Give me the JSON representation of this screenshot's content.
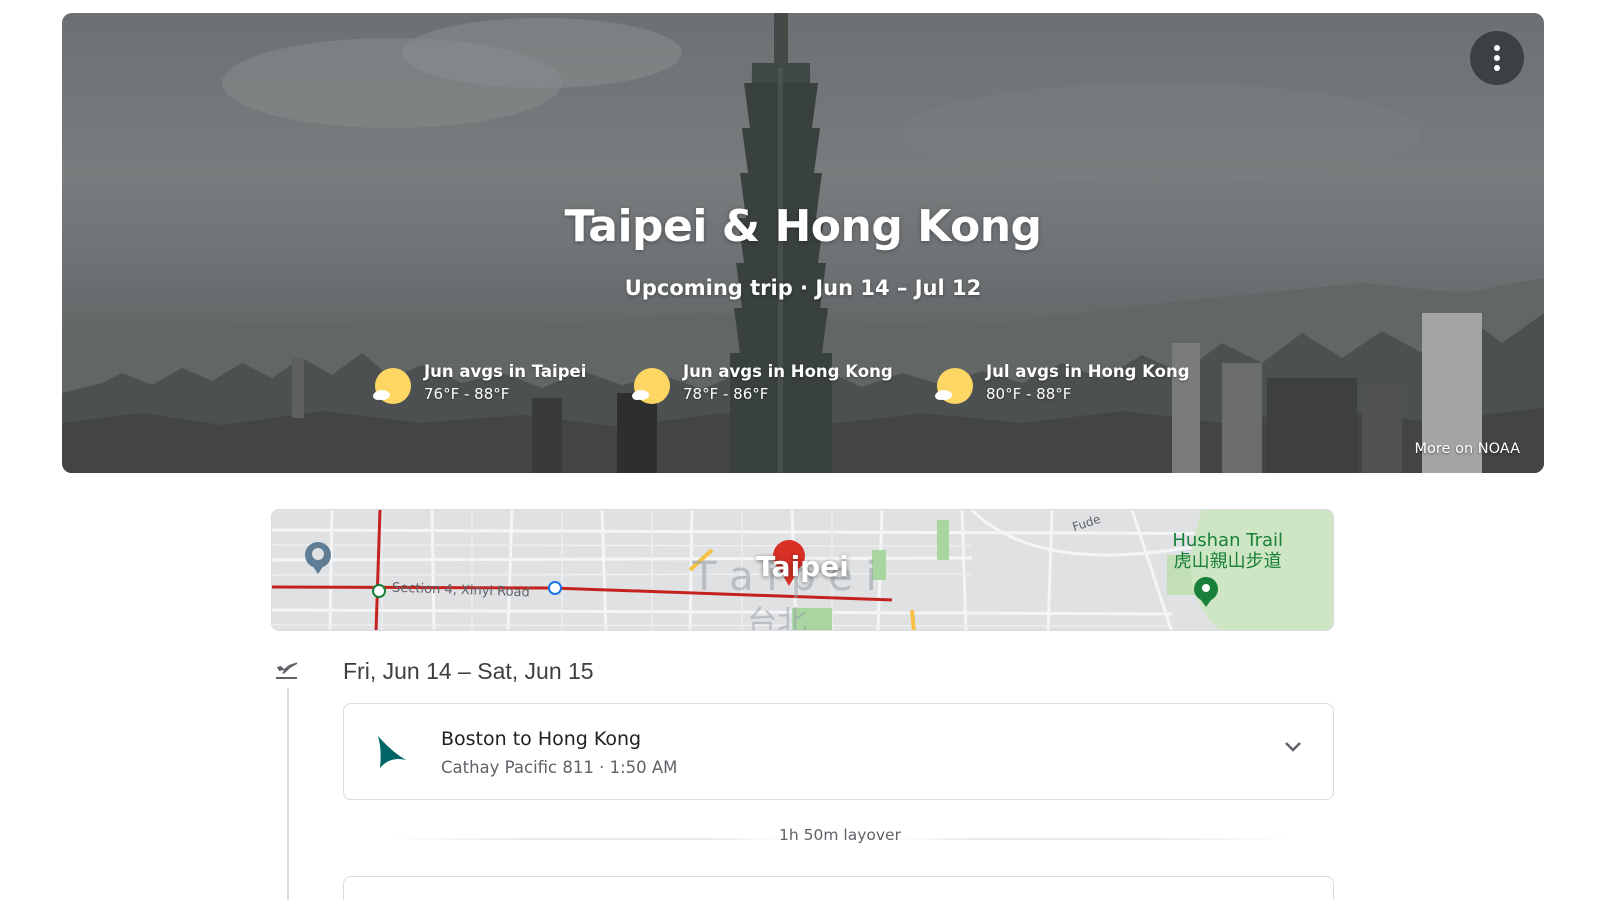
{
  "hero": {
    "title": "Taipei & Hong Kong",
    "subtitle": "Upcoming trip · Jun 14 – Jul 12",
    "menu_icon": "more-vert-icon",
    "weather": [
      {
        "label": "Jun avgs in Taipei",
        "temps": "76°F - 88°F",
        "icon": "partly-sunny-icon"
      },
      {
        "label": "Jun avgs in Hong Kong",
        "temps": "78°F - 86°F",
        "icon": "partly-sunny-icon"
      },
      {
        "label": "Jul avgs in Hong Kong",
        "temps": "80°F - 88°F",
        "icon": "partly-sunny-icon"
      }
    ],
    "source_link": "More on NOAA"
  },
  "map": {
    "city": "Taipei",
    "poi_name": "Hushan Trail",
    "poi_name_local": "虎山親山步道",
    "street": "Section 4, Xinyi Road",
    "street_2": "Fude",
    "city_watermark": "T a i p e i",
    "city_watermark_local": "台北",
    "colors": {
      "route": "#c5221f",
      "park": "#7cc47f",
      "pin": "#d93025",
      "poi": "#188038"
    }
  },
  "timeline": {
    "date_range": "Fri, Jun 14 – Sat, Jun 15",
    "icon": "flight-takeoff-icon",
    "flight": {
      "route": "Boston to Hong Kong",
      "detail": "Cathay Pacific 811 · 1:50 AM",
      "airline_logo": "cathay-pacific-logo",
      "brand_color": "#006564"
    },
    "layover": "1h 50m layover"
  }
}
